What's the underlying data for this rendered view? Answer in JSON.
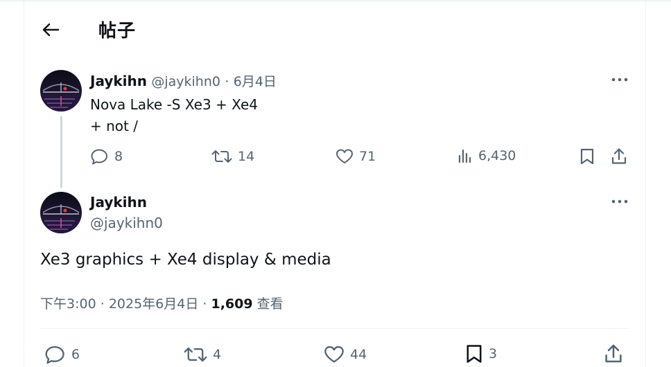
{
  "header": {
    "title": "帖子"
  },
  "parent_tweet": {
    "display_name": "Jaykihn",
    "handle": "@jaykihn0",
    "separator": "·",
    "date": "6月4日",
    "text_line1": "Nova Lake -S Xe3 + Xe4",
    "text_line2": "+ not /",
    "replies": "8",
    "retweets": "14",
    "likes": "71",
    "views": "6,430"
  },
  "main_tweet": {
    "display_name": "Jaykihn",
    "handle": "@jaykihn0",
    "text": "Xe3 graphics + Xe4 display & media",
    "time": "下午3:00",
    "separator1": "·",
    "date": "2025年6月4日",
    "separator2": "·",
    "view_count": "1,609",
    "view_label": "查看",
    "replies": "6",
    "retweets": "4",
    "likes": "44",
    "bookmarks": "3"
  },
  "colors": {
    "text": "#0f1419",
    "muted": "#536471",
    "border": "#eff3f4",
    "thread_line": "#cfd9de"
  }
}
